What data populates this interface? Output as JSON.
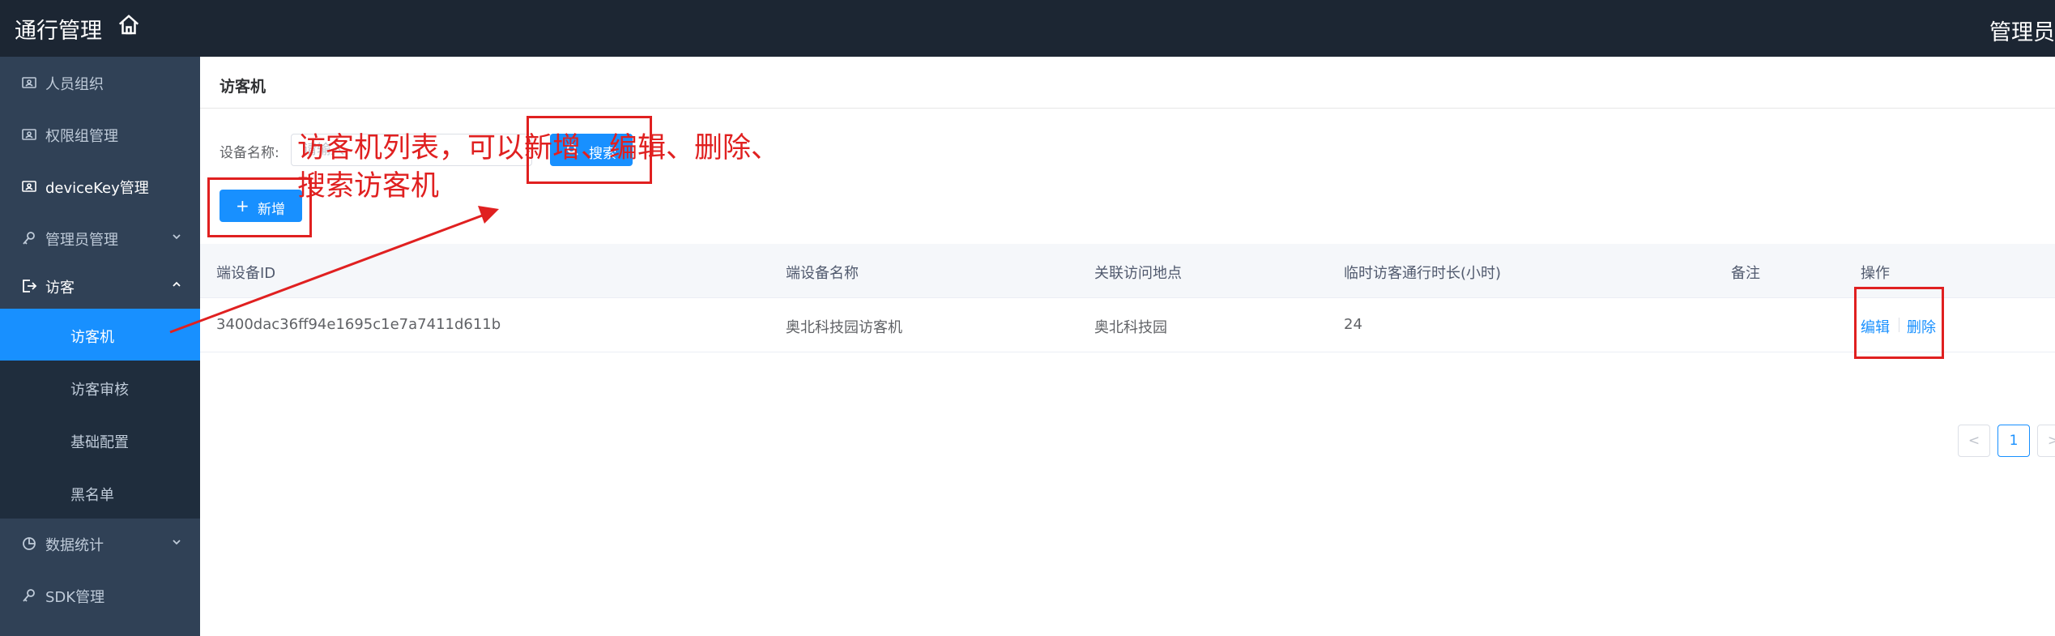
{
  "header": {
    "app_title": "通行管理",
    "user_label": "管理员"
  },
  "sidebar": {
    "items": [
      {
        "label": "人员组织",
        "icon": "id-card-icon"
      },
      {
        "label": "权限组管理",
        "icon": "id-card-icon"
      },
      {
        "label": "deviceKey管理",
        "icon": "id-card-icon"
      },
      {
        "label": "管理员管理",
        "icon": "key-icon"
      },
      {
        "label": "访客",
        "icon": "logout-icon"
      },
      {
        "label": "数据统计",
        "icon": "pie-chart-icon"
      },
      {
        "label": "SDK管理",
        "icon": "key-icon"
      }
    ],
    "submenu": [
      {
        "label": "访客机",
        "active": true
      },
      {
        "label": "访客审核"
      },
      {
        "label": "基础配置"
      },
      {
        "label": "黑名单"
      }
    ]
  },
  "main": {
    "page_title": "访客机",
    "search": {
      "label": "设备名称:",
      "placeholder": "请输入",
      "value": "",
      "button_label": "搜索"
    },
    "add_button_label": "新增",
    "annotation": "访客机列表，可以新增、编辑、删除、搜索访客机",
    "table": {
      "columns": [
        "端设备ID",
        "端设备名称",
        "关联访问地点",
        "临时访客通行时长(小时)",
        "备注",
        "操作"
      ],
      "rows": [
        {
          "id": "3400dac36ff94e1695c1e7a7411d611b",
          "name": "奥北科技园访客机",
          "location": "奥北科技园",
          "duration": "24",
          "remark": "",
          "edit_label": "编辑",
          "delete_label": "删除"
        }
      ]
    },
    "pagination": {
      "current_page": "1",
      "prev_label": "<",
      "next_label": ">"
    }
  },
  "colors": {
    "topbar": "#1c2633",
    "sidebar": "#304156",
    "submenu": "#1f2d3d",
    "accent": "#1890ff",
    "annotation": "#e02020"
  }
}
